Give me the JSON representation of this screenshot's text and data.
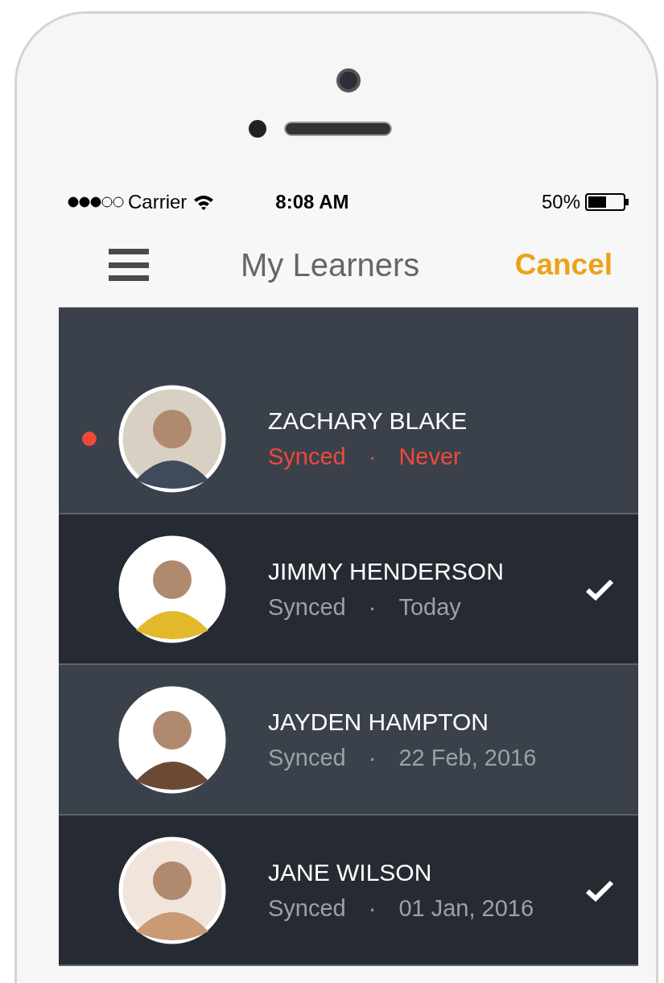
{
  "status_bar": {
    "carrier": "Carrier",
    "time": "8:08 AM",
    "battery": "50%"
  },
  "nav": {
    "title": "My Learners",
    "action": "Cancel"
  },
  "learners": [
    {
      "name": "ZACHARY BLAKE",
      "synced_label": "Synced",
      "separator": "·",
      "synced_date": "Never",
      "alert": true,
      "checked": false
    },
    {
      "name": "JIMMY HENDERSON",
      "synced_label": "Synced",
      "separator": "·",
      "synced_date": "Today",
      "alert": false,
      "checked": true
    },
    {
      "name": "JAYDEN HAMPTON",
      "synced_label": "Synced",
      "separator": "·",
      "synced_date": "22 Feb, 2016",
      "alert": false,
      "checked": false
    },
    {
      "name": "JANE WILSON",
      "synced_label": "Synced",
      "separator": "·",
      "synced_date": "01 Jan, 2016",
      "alert": false,
      "checked": true
    }
  ]
}
